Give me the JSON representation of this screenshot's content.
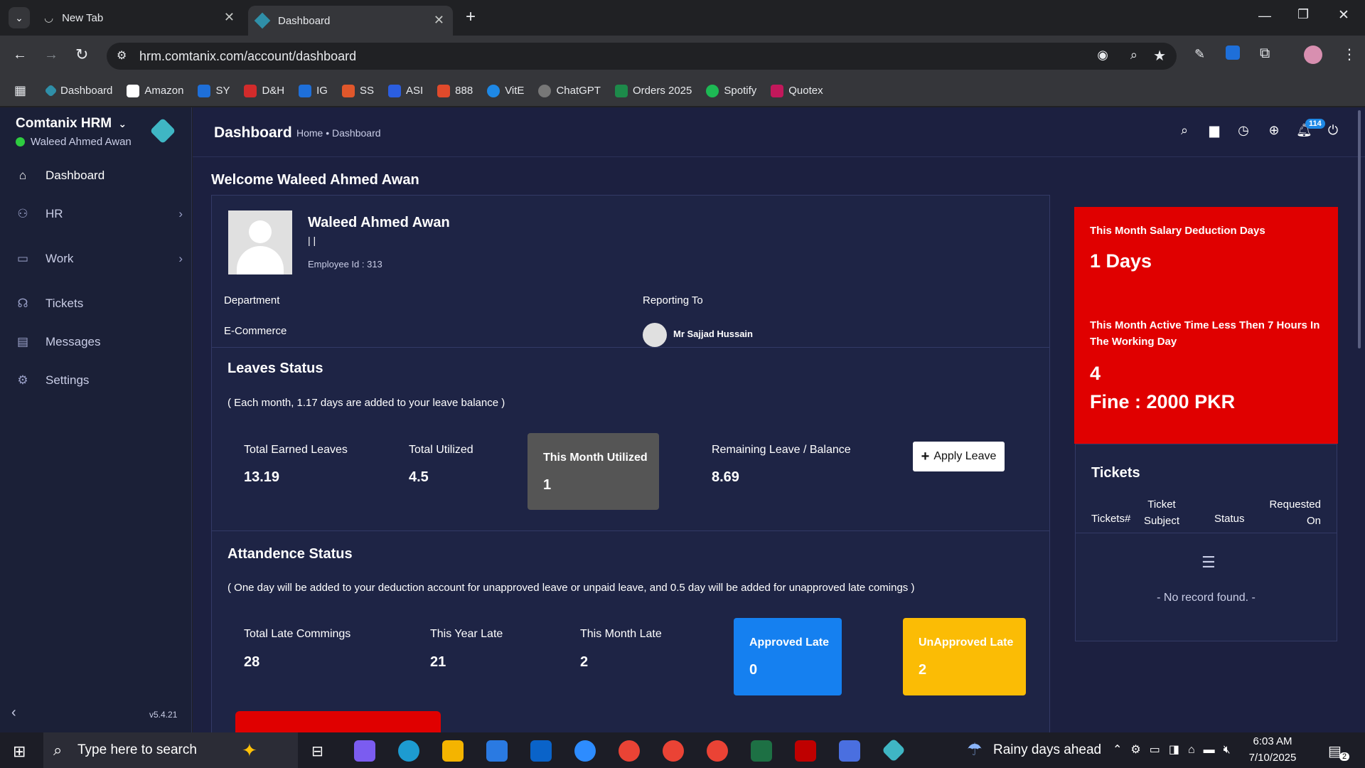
{
  "browser": {
    "tabs": [
      {
        "label": "New Tab"
      },
      {
        "label": "Dashboard"
      }
    ],
    "url": "hrm.comtanix.com/account/dashboard",
    "bookmarks": [
      {
        "label": "Dashboard",
        "color": "#2f8fa8"
      },
      {
        "label": "Amazon",
        "color": "#222222"
      },
      {
        "label": "SY",
        "color": "#1e6fd9"
      },
      {
        "label": "D&H",
        "color": "#d22b2b"
      },
      {
        "label": "IG",
        "color": "#1e6fd9"
      },
      {
        "label": "SS",
        "color": "#e0572b"
      },
      {
        "label": "ASI",
        "color": "#2b5ee0"
      },
      {
        "label": "888",
        "color": "#e04a2b"
      },
      {
        "label": "VitE",
        "color": "#1e88e5"
      },
      {
        "label": "ChatGPT",
        "color": "#777777"
      },
      {
        "label": "Orders 2025",
        "color": "#1d8a4a"
      },
      {
        "label": "Spotify",
        "color": "#1db954"
      },
      {
        "label": "Quotex",
        "color": "#c2185b"
      }
    ]
  },
  "app": {
    "name": "Comtanix HRM",
    "user": "Waleed Ahmed Awan",
    "version": "v5.4.21",
    "nav": [
      {
        "label": "Dashboard"
      },
      {
        "label": "HR"
      },
      {
        "label": "Work"
      },
      {
        "label": "Tickets"
      },
      {
        "label": "Messages"
      },
      {
        "label": "Settings"
      }
    ],
    "page_title": "Dashboard",
    "breadcrumb": "Home • Dashboard",
    "notif_count": "114"
  },
  "welcome": "Welcome Waleed Ahmed Awan",
  "profile": {
    "name": "Waleed Ahmed Awan",
    "sub": "| |",
    "employee_id": "Employee Id : 313",
    "department_label": "Department",
    "department": "E-Commerce",
    "reporting_label": "Reporting To",
    "reporting_to": "Mr Sajjad Hussain"
  },
  "leaves": {
    "title": "Leaves Status",
    "note": "( Each month, 1.17 days are added to your leave balance )",
    "total_earned_label": "Total Earned Leaves",
    "total_earned": "13.19",
    "total_utilized_label": "Total Utilized",
    "total_utilized": "4.5",
    "month_utilized_label": "This Month Utilized",
    "month_utilized": "1",
    "remaining_label": "Remaining Leave / Balance",
    "remaining": "8.69",
    "apply_label": "Apply Leave"
  },
  "attendance": {
    "title": "Attandence Status",
    "note": "( One day will be added to your deduction account for unapproved leave or unpaid leave, and 0.5 day will be added for unapproved late comings )",
    "late_label": "Total Late Commings",
    "late": "28",
    "year_label": "This Year Late",
    "year": "21",
    "month_label": "This Month Late",
    "month": "2",
    "approved_label": "Approved Late",
    "approved": "0",
    "unapproved_label": "UnApproved Late",
    "unapproved": "2"
  },
  "salary": {
    "deduction_label": "This Month Salary Deduction Days",
    "deduction": "1 Days",
    "active_label": "This Month Active Time Less Then 7 Hours In The Working Day",
    "active": "4",
    "fine": "Fine : 2000 PKR"
  },
  "tickets": {
    "title": "Tickets",
    "columns": [
      "Tickets#",
      "Ticket Subject",
      "Status",
      "Requested On"
    ],
    "empty": "- No record found. -"
  },
  "taskbar": {
    "search_placeholder": "Type here to search",
    "weather": "Rainy days ahead",
    "time": "6:03 AM",
    "date": "7/10/2025",
    "notif": "2"
  }
}
